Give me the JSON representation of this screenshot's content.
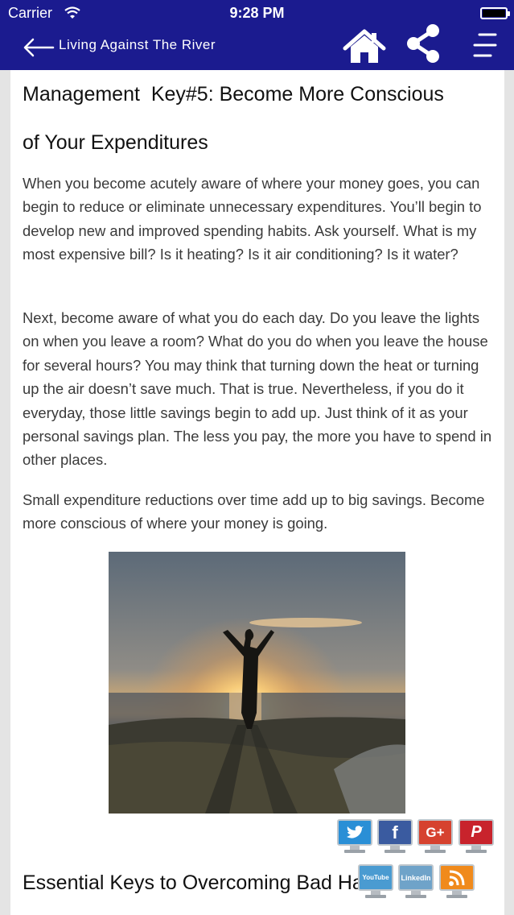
{
  "status": {
    "carrier": "Carrier",
    "time": "9:28 PM"
  },
  "nav": {
    "title": "Living Against The River"
  },
  "article": {
    "heading_line1": "Management  Key#5: Become More Conscious",
    "heading_line2": "of Your Expenditures",
    "paragraphs": [
      "When you become acutely aware of where your money goes, you can begin to reduce or eliminate unnecessary expenditures. You’ll begin to develop new and improved spending habits. Ask yourself. What is my most expensive bill? Is it heating? Is it air conditioning? Is it water?",
      "Next, become aware of what you do each day. Do you leave the lights on when you leave a room? What do you do when you leave the house for several hours? You may think that turning down the heat or turning up the air doesn’t save much. That is true. Nevertheless, if you do it everyday, those little savings begin to add up. Just think of it as your personal savings plan. The less you pay, the more you have to spend in other places.",
      "Small expenditure reductions over time add up to big savings. Become more conscious of where your money is going."
    ],
    "next_heading": "Essential Keys to Overcoming Bad Habit"
  },
  "social": {
    "twitter": {
      "label": "",
      "color": "#2a8fd6"
    },
    "facebook": {
      "label": "f",
      "color": "#3a5ba0"
    },
    "googleplus": {
      "label": "G+",
      "color": "#d6422f"
    },
    "pinterest": {
      "label": "P",
      "color": "#c8232c"
    },
    "youtube": {
      "label": "YouTube",
      "color": "#4a9bd1"
    },
    "linkedin": {
      "label": "LinkedIn",
      "color": "#6fa3c9"
    },
    "rss": {
      "label": "",
      "color": "#f08a1c"
    }
  },
  "colors": {
    "nav_bg": "#1b1b8f",
    "page_bg": "#e4e4e4",
    "text": "#3a3a3a"
  }
}
